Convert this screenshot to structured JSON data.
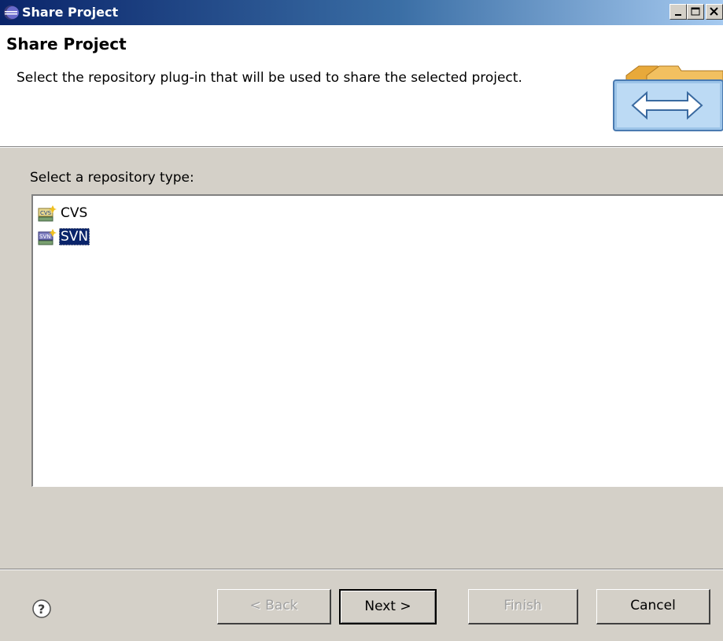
{
  "window": {
    "title": "Share Project"
  },
  "header": {
    "title": "Share Project",
    "description": "Select the repository plug-in that will be used to share the selected project."
  },
  "repository_list": {
    "label": "Select a repository type:",
    "items": [
      {
        "label": "CVS",
        "icon": "cvs-repository-icon",
        "selected": false
      },
      {
        "label": "SVN",
        "icon": "svn-repository-icon",
        "selected": true
      }
    ]
  },
  "buttons": {
    "back": "< Back",
    "next": "Next >",
    "finish": "Finish",
    "cancel": "Cancel"
  },
  "colors": {
    "selection": "#0a246a",
    "dialog_bg": "#d4d0c8",
    "title_bar": "#0a246a"
  }
}
